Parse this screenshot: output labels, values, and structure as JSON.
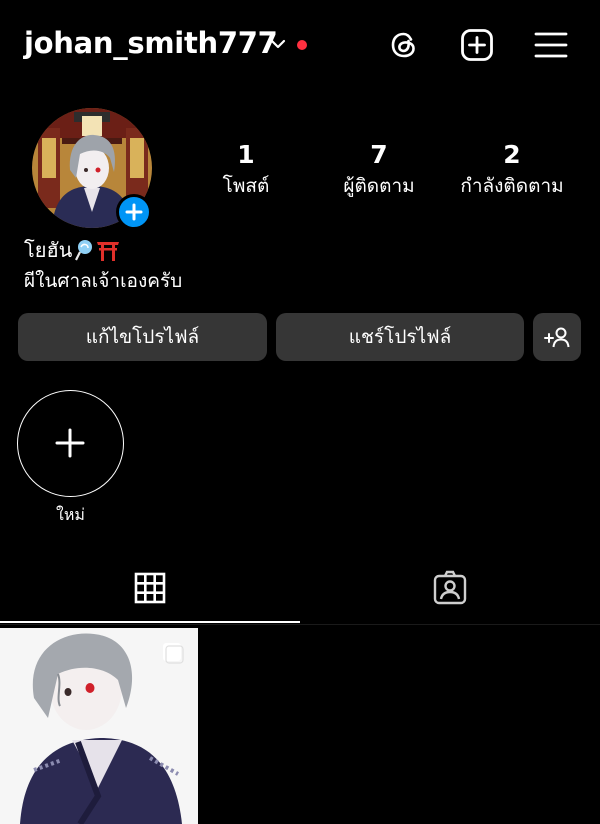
{
  "header": {
    "username": "johan_smith777",
    "icons": [
      "chevron-down-icon",
      "notification-dot",
      "threads-icon",
      "create-post-icon",
      "menu-icon"
    ],
    "notification_color": "#ff3040"
  },
  "profile": {
    "stats": [
      {
        "value": "1",
        "label": "โพสต์"
      },
      {
        "value": "7",
        "label": "ผู้ติดตาม"
      },
      {
        "value": "2",
        "label": "กำลังติดตาม"
      }
    ],
    "display_name": "โยฮัน",
    "name_emojis": [
      "lollipop-icon",
      "torii-icon"
    ],
    "bio": "ผีในศาลเจ้าเองครับ",
    "badge_color": "#0095f6"
  },
  "actions": {
    "edit_profile": "แก้ไขโปรไฟล์",
    "share_profile": "แชร์โปรไฟล์"
  },
  "highlights": {
    "new_label": "ใหม่"
  },
  "tabs": [
    "grid-icon",
    "tagged-icon"
  ]
}
